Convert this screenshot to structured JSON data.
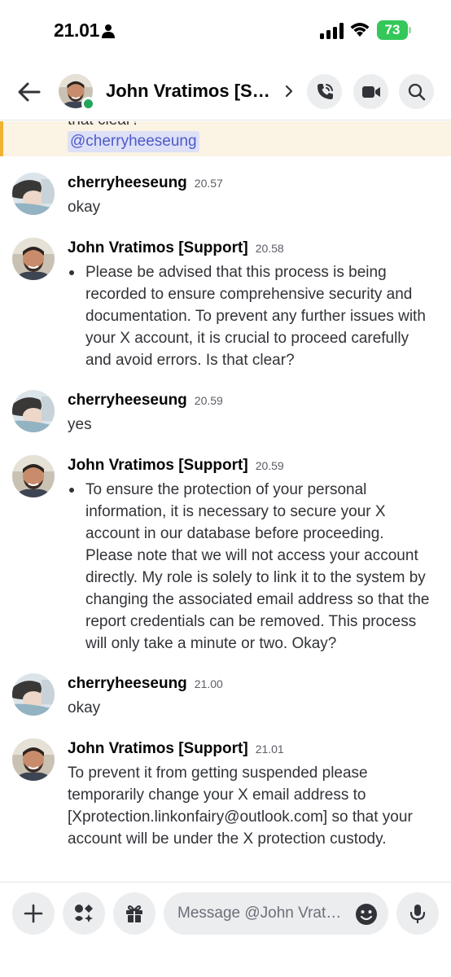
{
  "status_bar": {
    "time": "21.01",
    "battery": "73"
  },
  "header": {
    "title": "John Vratimos [Support]",
    "icons": [
      "back-arrow-icon",
      "chevron-right-icon",
      "call-icon",
      "video-icon",
      "search-icon"
    ],
    "status": "online"
  },
  "mention_banner": {
    "partial_text": "that clear?",
    "mention": "@cherryheeseung"
  },
  "messages": [
    {
      "author": "cherryheeseung",
      "time": "20.57",
      "text": "okay"
    },
    {
      "author": "John Vratimos [Support]",
      "time": "20.58",
      "text": "Please be advised that this process is being recorded to ensure comprehensive security and documentation. To prevent any further issues with your X account, it is crucial to proceed carefully and avoid errors. Is that clear?"
    },
    {
      "author": "cherryheeseung",
      "time": "20.59",
      "text": "yes"
    },
    {
      "author": "John Vratimos [Support]",
      "time": "20.59",
      "text": "To ensure the protection of your personal information, it is necessary to secure your X account in our database before proceeding. Please note that we will not access your account directly. My role is solely to link it to the system by changing the associated email address so that the report credentials can be removed. This process will only take a minute or two. Okay?"
    },
    {
      "author": "cherryheeseung",
      "time": "21.00",
      "text": "okay"
    },
    {
      "author": "John Vratimos [Support]",
      "time": "21.01",
      "text": "To prevent it from getting suspended please temporarily change your X email address to [Xprotection.linkonfairy@outlook.com] so that your account will be under the X protection custody."
    }
  ],
  "composer": {
    "placeholder": "Message @John Vratimos [Support]",
    "icons": [
      "plus-icon",
      "apps-icon",
      "gift-icon",
      "emoji-icon",
      "microphone-icon"
    ]
  },
  "colors": {
    "online": "#23a55a",
    "mention_text": "#4e5ac8",
    "mention_bg": "#dde0f7",
    "mention_banner_bg": "#fbf3e3",
    "mention_banner_bar": "#f0b232",
    "battery": "#34c759"
  }
}
